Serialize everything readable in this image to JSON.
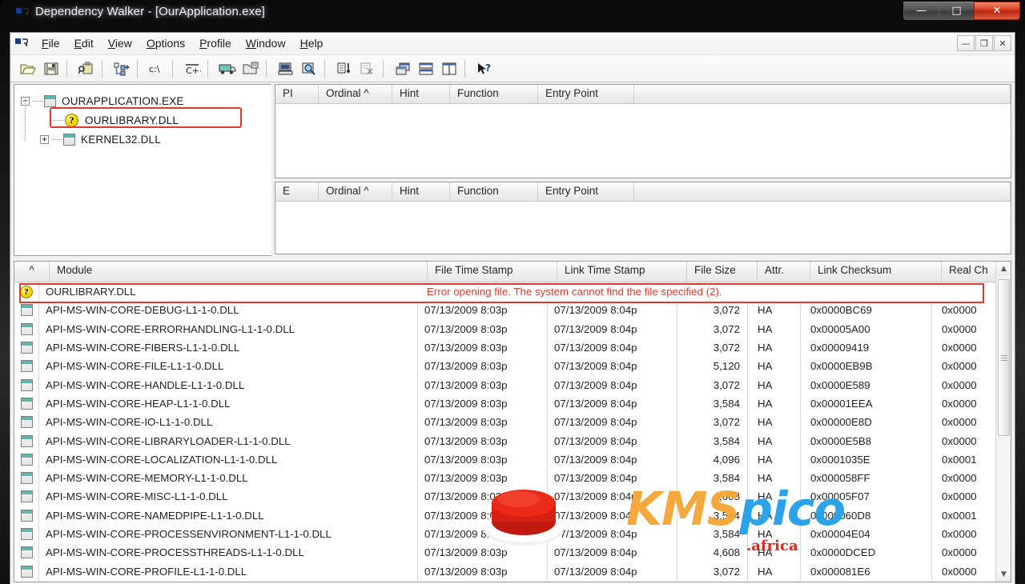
{
  "window": {
    "title": "Dependency Walker - [OurApplication.exe]",
    "app_icon": "dependency-walker-icon",
    "caption_buttons": [
      {
        "name": "minimize",
        "glyph": "—"
      },
      {
        "name": "maximize",
        "glyph": "□"
      },
      {
        "name": "close",
        "glyph": "✕"
      }
    ],
    "mdi_caption_buttons": [
      {
        "name": "mdi-minimize",
        "glyph": "—"
      },
      {
        "name": "mdi-restore",
        "glyph": "❐"
      },
      {
        "name": "mdi-close",
        "glyph": "✕"
      }
    ]
  },
  "menu": {
    "items": [
      {
        "label": "File",
        "accel": "F"
      },
      {
        "label": "Edit",
        "accel": "E"
      },
      {
        "label": "View",
        "accel": "V"
      },
      {
        "label": "Options",
        "accel": "O"
      },
      {
        "label": "Profile",
        "accel": "P"
      },
      {
        "label": "Window",
        "accel": "W"
      },
      {
        "label": "Help",
        "accel": "H"
      }
    ]
  },
  "toolbar": {
    "buttons": [
      {
        "name": "open-file-icon",
        "tip": "Open"
      },
      {
        "name": "save-icon",
        "tip": "Save"
      },
      {
        "sep": true
      },
      {
        "name": "view-module-search-order-icon",
        "tip": "Module Search Order"
      },
      {
        "sep": true
      },
      {
        "name": "expand-all-icon",
        "tip": "Expand All"
      },
      {
        "sep": true
      },
      {
        "name": "view-path-icon",
        "tip": "Full Paths"
      },
      {
        "sep": true
      },
      {
        "name": "undecorate-cpp-icon",
        "tip": "Undecorate C++ Functions"
      },
      {
        "sep": true
      },
      {
        "name": "start-profiling-icon",
        "tip": "Start Profiling"
      },
      {
        "name": "configure-module-search-icon",
        "tip": "Configure Module Search"
      },
      {
        "sep": true
      },
      {
        "name": "system-info-icon",
        "tip": "System Information"
      },
      {
        "name": "view-external-viewer-icon",
        "tip": "External Viewer"
      },
      {
        "sep": true
      },
      {
        "name": "sort-ordinal-icon",
        "tip": "Sort By Ordinal"
      },
      {
        "name": "clear-log-icon",
        "tip": "Clear Log Window"
      },
      {
        "sep": true
      },
      {
        "name": "auto-expand-icon",
        "tip": "Auto Expand"
      },
      {
        "name": "full-paths-toggle-icon",
        "tip": "Horizontal Layout"
      },
      {
        "name": "split-panes-icon",
        "tip": "Vertical Layout"
      },
      {
        "sep": true
      },
      {
        "name": "context-help-icon",
        "tip": "Context Help"
      }
    ]
  },
  "tree": {
    "nodes": [
      {
        "label": "OURAPPLICATION.EXE",
        "expander": "−",
        "icon": "module-icon",
        "depth": 0,
        "highlighted": false
      },
      {
        "label": "OURLIBRARY.DLL",
        "expander": "",
        "icon": "question-warning-icon",
        "depth": 1,
        "highlighted": true
      },
      {
        "label": "KERNEL32.DLL",
        "expander": "+",
        "icon": "module-icon",
        "depth": 1,
        "highlighted": false
      }
    ]
  },
  "parent_imports": {
    "columns": [
      "PI",
      "Ordinal ^",
      "Hint",
      "Function",
      "Entry Point"
    ],
    "rows": []
  },
  "exports": {
    "columns": [
      "E",
      "Ordinal ^",
      "Hint",
      "Function",
      "Entry Point"
    ],
    "rows": []
  },
  "module_list": {
    "columns": [
      "^",
      "Module",
      "File Time Stamp",
      "Link Time Stamp",
      "File Size",
      "Attr.",
      "Link Checksum",
      "Real Ch"
    ],
    "sort_indicator": "▲",
    "error_row": {
      "icon": "question-warning-icon",
      "module": "OURLIBRARY.DLL",
      "message": "Error opening file. The system cannot find the file specified (2).",
      "message_color": "#e23a2e",
      "outline_color": "#e03a2f"
    },
    "rows": [
      {
        "module": "API-MS-WIN-CORE-DEBUG-L1-1-0.DLL",
        "file_time": "07/13/2009  8:03p",
        "link_time": "07/13/2009  8:04p",
        "file_size": "3,072",
        "attr": "HA",
        "link_checksum": "0x0000BC69",
        "real_checksum": "0x0000"
      },
      {
        "module": "API-MS-WIN-CORE-ERRORHANDLING-L1-1-0.DLL",
        "file_time": "07/13/2009  8:03p",
        "link_time": "07/13/2009  8:04p",
        "file_size": "3,072",
        "attr": "HA",
        "link_checksum": "0x00005A00",
        "real_checksum": "0x0000"
      },
      {
        "module": "API-MS-WIN-CORE-FIBERS-L1-1-0.DLL",
        "file_time": "07/13/2009  8:03p",
        "link_time": "07/13/2009  8:04p",
        "file_size": "3,072",
        "attr": "HA",
        "link_checksum": "0x00009419",
        "real_checksum": "0x0000"
      },
      {
        "module": "API-MS-WIN-CORE-FILE-L1-1-0.DLL",
        "file_time": "07/13/2009  8:03p",
        "link_time": "07/13/2009  8:04p",
        "file_size": "5,120",
        "attr": "HA",
        "link_checksum": "0x0000EB9B",
        "real_checksum": "0x0000"
      },
      {
        "module": "API-MS-WIN-CORE-HANDLE-L1-1-0.DLL",
        "file_time": "07/13/2009  8:03p",
        "link_time": "07/13/2009  8:04p",
        "file_size": "3,072",
        "attr": "HA",
        "link_checksum": "0x0000E589",
        "real_checksum": "0x0000"
      },
      {
        "module": "API-MS-WIN-CORE-HEAP-L1-1-0.DLL",
        "file_time": "07/13/2009  8:03p",
        "link_time": "07/13/2009  8:04p",
        "file_size": "3,584",
        "attr": "HA",
        "link_checksum": "0x00001EEA",
        "real_checksum": "0x0000"
      },
      {
        "module": "API-MS-WIN-CORE-IO-L1-1-0.DLL",
        "file_time": "07/13/2009  8:03p",
        "link_time": "07/13/2009  8:04p",
        "file_size": "3,072",
        "attr": "HA",
        "link_checksum": "0x00000E8D",
        "real_checksum": "0x0000"
      },
      {
        "module": "API-MS-WIN-CORE-LIBRARYLOADER-L1-1-0.DLL",
        "file_time": "07/13/2009  8:03p",
        "link_time": "07/13/2009  8:04p",
        "file_size": "3,584",
        "attr": "HA",
        "link_checksum": "0x0000E5B8",
        "real_checksum": "0x0000"
      },
      {
        "module": "API-MS-WIN-CORE-LOCALIZATION-L1-1-0.DLL",
        "file_time": "07/13/2009  8:03p",
        "link_time": "07/13/2009  8:04p",
        "file_size": "4,096",
        "attr": "HA",
        "link_checksum": "0x0001035E",
        "real_checksum": "0x0001"
      },
      {
        "module": "API-MS-WIN-CORE-MEMORY-L1-1-0.DLL",
        "file_time": "07/13/2009  8:03p",
        "link_time": "07/13/2009  8:04p",
        "file_size": "3,584",
        "attr": "HA",
        "link_checksum": "0x000058FF",
        "real_checksum": "0x0000"
      },
      {
        "module": "API-MS-WIN-CORE-MISC-L1-1-0.DLL",
        "file_time": "07/13/2009  8:03p",
        "link_time": "07/13/2009  8:04p",
        "file_size": "4,608",
        "attr": "HA",
        "link_checksum": "0x00005F07",
        "real_checksum": "0x0000"
      },
      {
        "module": "API-MS-WIN-CORE-NAMEDPIPE-L1-1-0.DLL",
        "file_time": "07/13/2009  8:03p",
        "link_time": "07/13/2009  8:04p",
        "file_size": "3,584",
        "attr": "HA",
        "link_checksum": "0x000060D8",
        "real_checksum": "0x0001"
      },
      {
        "module": "API-MS-WIN-CORE-PROCESSENVIRONMENT-L1-1-0.DLL",
        "file_time": "07/13/2009  8:03p",
        "link_time": "07/13/2009  8:04p",
        "file_size": "3,584",
        "attr": "HA",
        "link_checksum": "0x00004E04",
        "real_checksum": "0x0000"
      },
      {
        "module": "API-MS-WIN-CORE-PROCESSTHREADS-L1-1-0.DLL",
        "file_time": "07/13/2009  8:03p",
        "link_time": "07/13/2009  8:04p",
        "file_size": "4,608",
        "attr": "HA",
        "link_checksum": "0x0000DCED",
        "real_checksum": "0x0000"
      },
      {
        "module": "API-MS-WIN-CORE-PROFILE-L1-1-0.DLL",
        "file_time": "07/13/2009  8:03p",
        "link_time": "07/13/2009  8:04p",
        "file_size": "3,072",
        "attr": "HA",
        "link_checksum": "0x000081E6",
        "real_checksum": "0x0000"
      }
    ],
    "scrollbar": {
      "up_glyph": "▲",
      "down_glyph": "▼"
    }
  },
  "watermark": {
    "text_parts": [
      {
        "text": "KMS",
        "color": "#f5a93c"
      },
      {
        "text": "pico",
        "color": "#2aa3e8"
      }
    ],
    "suffix": ".africa",
    "suffix_color": "#e2241a",
    "button_icon": "red-push-button-icon"
  }
}
